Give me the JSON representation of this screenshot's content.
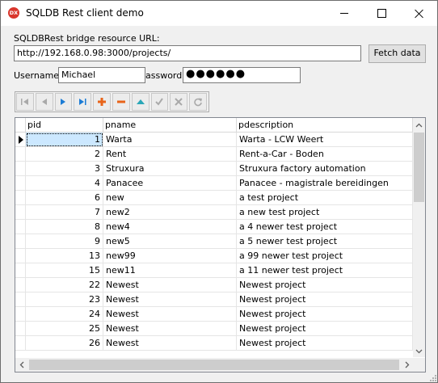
{
  "window": {
    "title": "SQLDB Rest client demo",
    "app_icon_text": "DX"
  },
  "form": {
    "url_label": "SQLDBRest bridge resource URL:",
    "url_value": "http://192.168.0.98:3000/projects/",
    "fetch_label": "Fetch data",
    "username_label": "Username",
    "username_value": "Michael",
    "password_label": "assword",
    "password_value": "●●●●●●"
  },
  "navigator": {
    "buttons": [
      "first",
      "prior",
      "next",
      "last",
      "insert",
      "delete",
      "edit",
      "post",
      "cancel",
      "refresh"
    ]
  },
  "grid": {
    "columns": [
      "pid",
      "pname",
      "pdescription"
    ],
    "rows": [
      {
        "pid": "1",
        "pname": "Warta",
        "pdescription": "Warta - LCW Weert"
      },
      {
        "pid": "2",
        "pname": "Rent",
        "pdescription": "Rent-a-Car - Boden"
      },
      {
        "pid": "3",
        "pname": "Struxura",
        "pdescription": "Struxura factory automation"
      },
      {
        "pid": "4",
        "pname": "Panacee",
        "pdescription": "Panacee - magistrale bereidingen"
      },
      {
        "pid": "6",
        "pname": "new",
        "pdescription": "a test project"
      },
      {
        "pid": "7",
        "pname": "new2",
        "pdescription": "a new test project"
      },
      {
        "pid": "8",
        "pname": "new4",
        "pdescription": "a 4 newer test project"
      },
      {
        "pid": "9",
        "pname": "new5",
        "pdescription": "a 5 newer test project"
      },
      {
        "pid": "13",
        "pname": "new99",
        "pdescription": "a 99 newer test project"
      },
      {
        "pid": "15",
        "pname": "new11",
        "pdescription": "a 11 newer test project"
      },
      {
        "pid": "22",
        "pname": "Newest",
        "pdescription": "Newest project"
      },
      {
        "pid": "23",
        "pname": "Newest",
        "pdescription": "Newest project"
      },
      {
        "pid": "24",
        "pname": "Newest",
        "pdescription": "Newest project"
      },
      {
        "pid": "25",
        "pname": "Newest",
        "pdescription": "Newest project"
      },
      {
        "pid": "26",
        "pname": "Newest",
        "pdescription": "Newest project"
      }
    ],
    "selected_row": 0
  },
  "colors": {
    "accent_blue": "#1c7cd5",
    "insert_orange": "#e8641a",
    "selection": "#cce8ff"
  }
}
